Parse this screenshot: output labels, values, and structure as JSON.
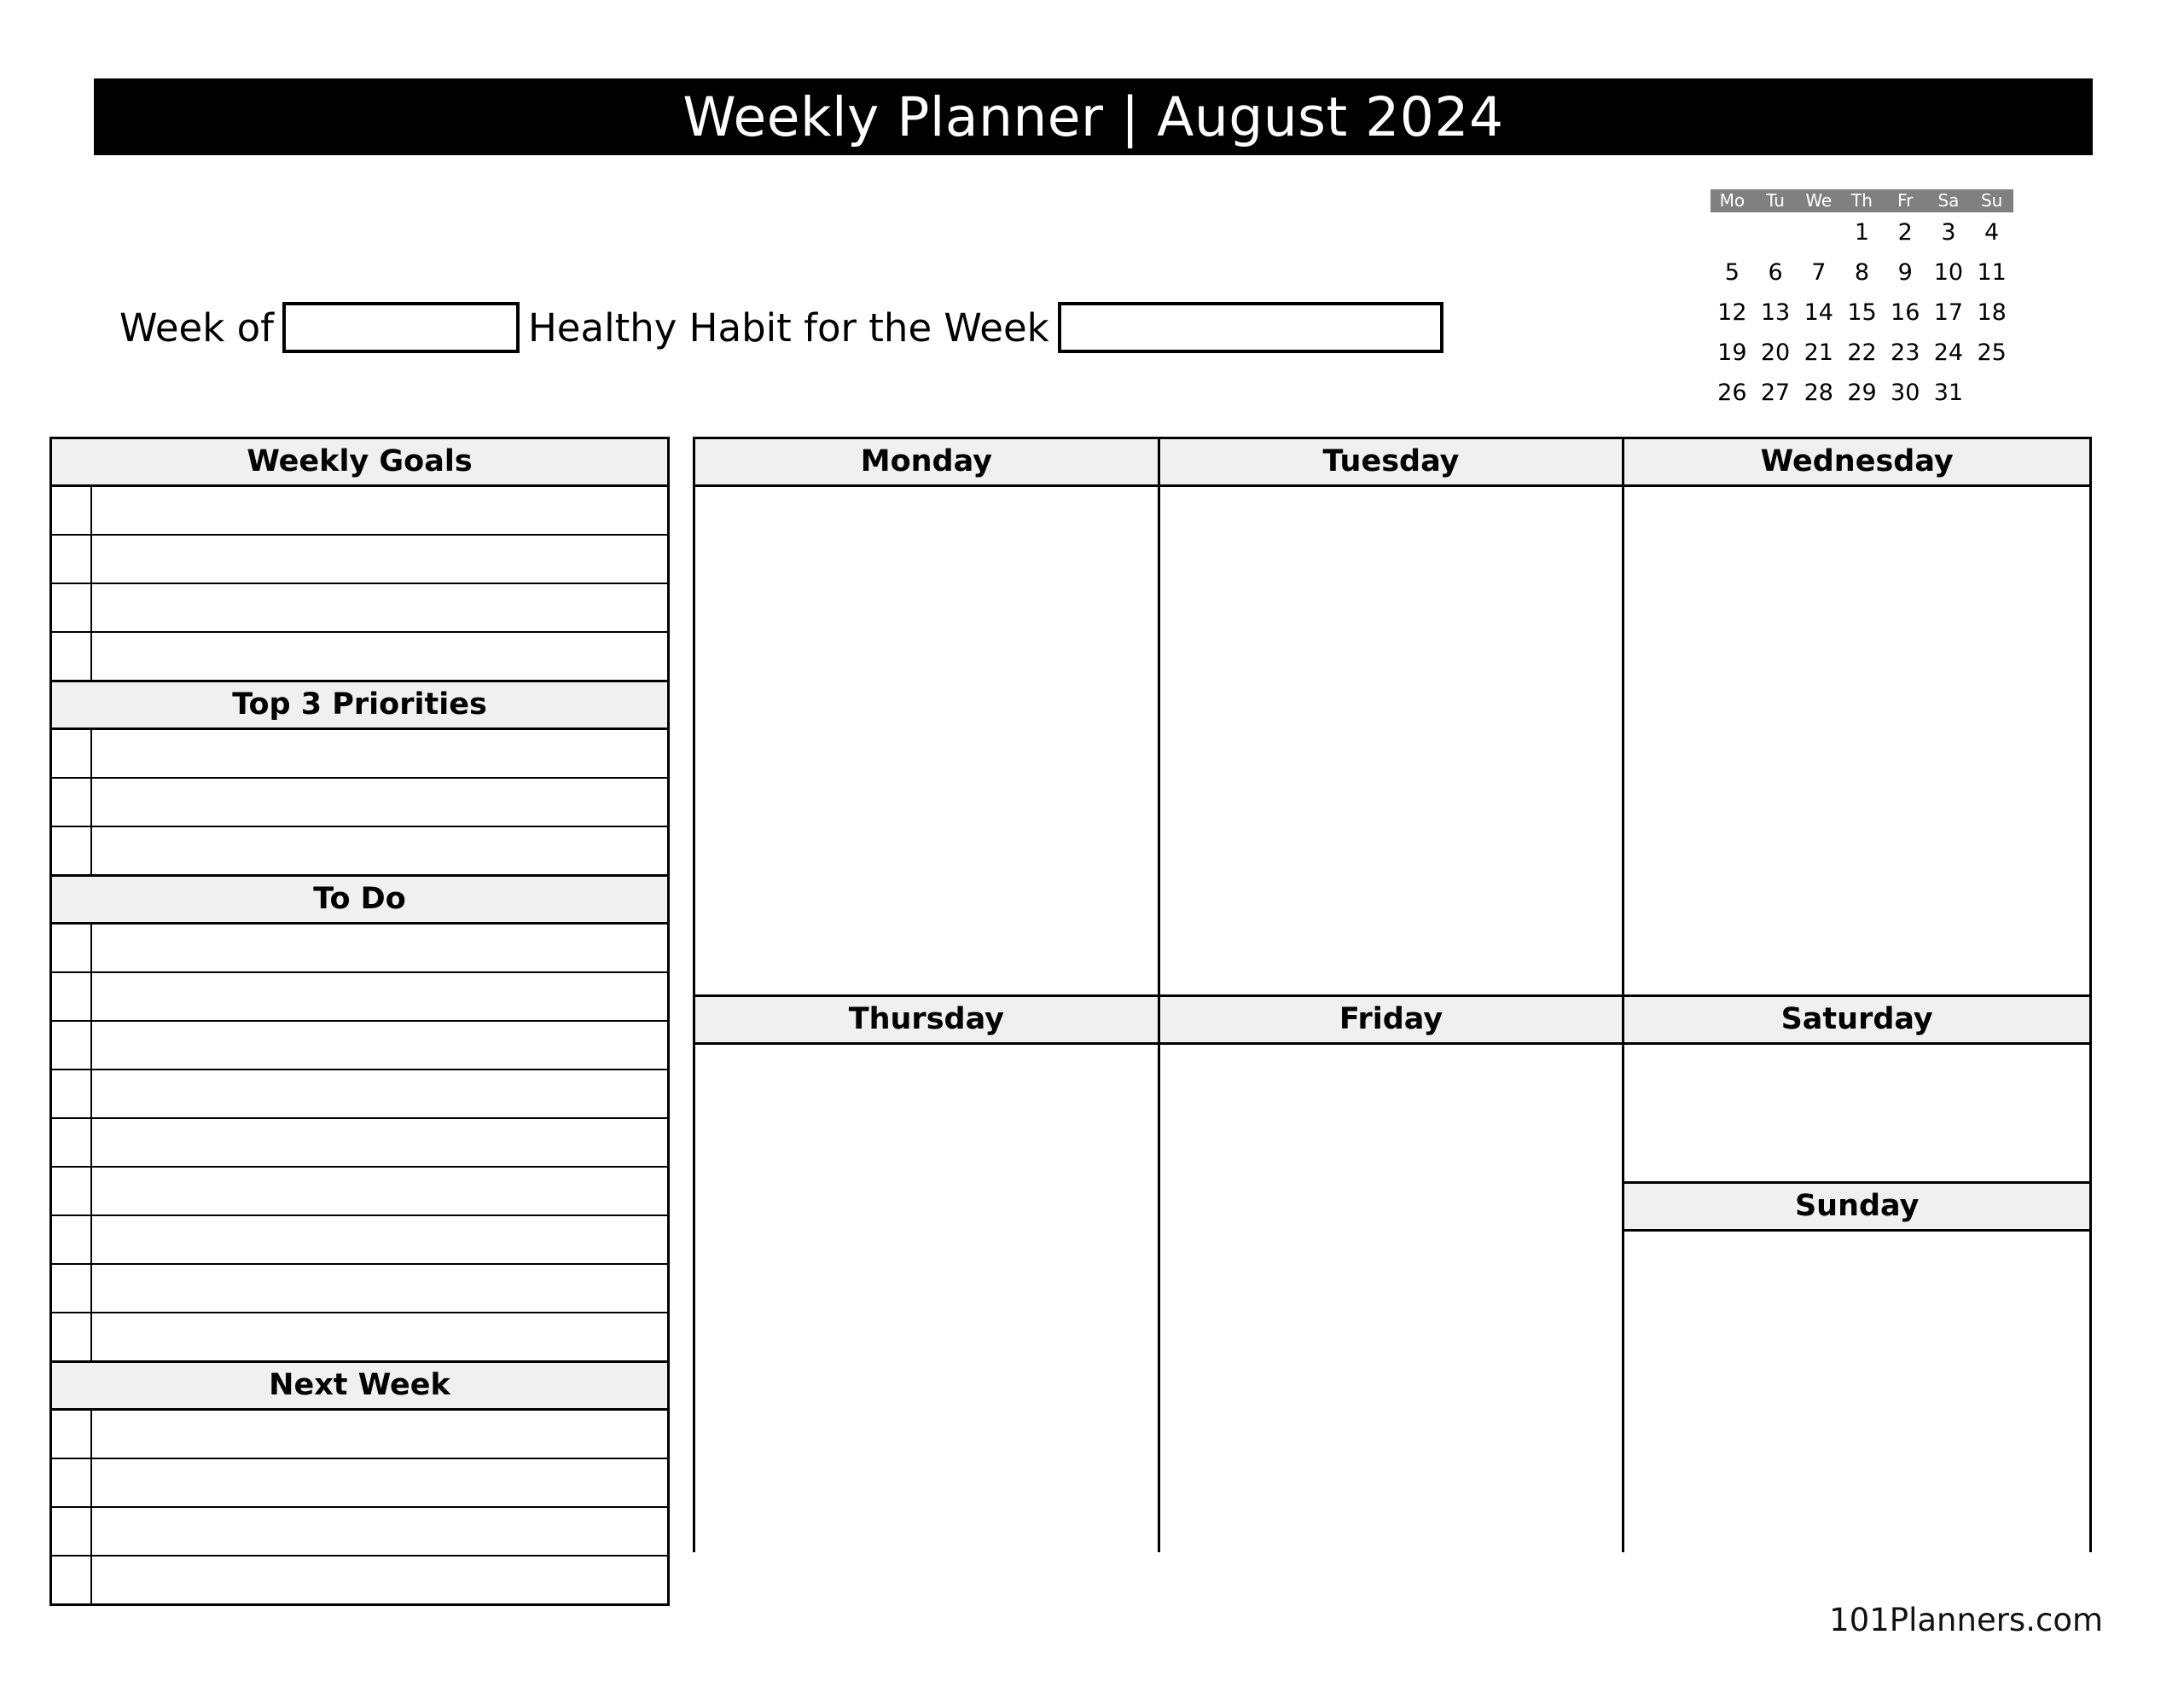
{
  "header": {
    "title": "Weekly Planner  |  August 2024"
  },
  "mini_calendar": {
    "weekday_headers": [
      "Mo",
      "Tu",
      "We",
      "Th",
      "Fr",
      "Sa",
      "Su"
    ],
    "cells": [
      "",
      "",
      "",
      "1",
      "2",
      "3",
      "4",
      "5",
      "6",
      "7",
      "8",
      "9",
      "10",
      "11",
      "12",
      "13",
      "14",
      "15",
      "16",
      "17",
      "18",
      "19",
      "20",
      "21",
      "22",
      "23",
      "24",
      "25",
      "26",
      "27",
      "28",
      "29",
      "30",
      "31",
      ""
    ],
    "header_bg": "#808080",
    "header_color": "#ffffff"
  },
  "fields": {
    "week_of_label": "Week of",
    "week_of_value": "",
    "habit_label": "Healthy Habit for the Week",
    "habit_value": ""
  },
  "sections": [
    {
      "title": "Weekly Goals",
      "rows": 4
    },
    {
      "title": "Top 3 Priorities",
      "rows": 3
    },
    {
      "title": "To Do",
      "rows": 9
    },
    {
      "title": "Next Week",
      "rows": 4
    }
  ],
  "days": {
    "monday": "Monday",
    "tuesday": "Tuesday",
    "wednesday": "Wednesday",
    "thursday": "Thursday",
    "friday": "Friday",
    "saturday": "Saturday",
    "sunday": "Sunday"
  },
  "footer": {
    "brand": "101Planners.com"
  },
  "colors": {
    "title_bar_bg": "#000000",
    "title_bar_text": "#ffffff",
    "section_head_bg": "#f0f0f0",
    "border": "#000000",
    "page_bg": "#ffffff"
  }
}
